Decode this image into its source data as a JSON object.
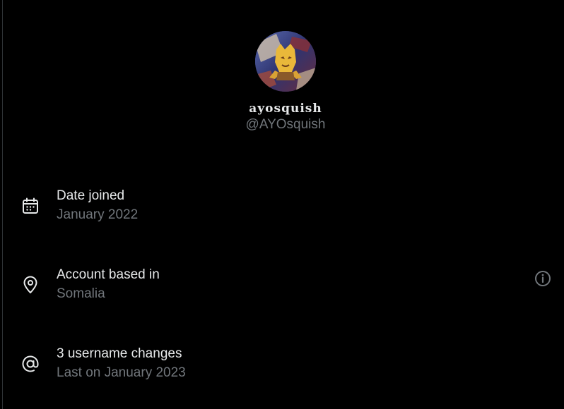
{
  "profile": {
    "display_name": "ayosquish",
    "handle": "@AYOsquish"
  },
  "about": {
    "items": [
      {
        "icon": "calendar-icon",
        "title": "Date joined",
        "value": "January 2022"
      },
      {
        "icon": "location-pin-icon",
        "title": "Account based in",
        "value": "Somalia"
      },
      {
        "icon": "at-sign-icon",
        "title": "3 username changes",
        "value": "Last on January 2023"
      }
    ]
  },
  "colors": {
    "background": "#000000",
    "primary_text": "#e7e9ea",
    "secondary_text": "#71767b"
  }
}
